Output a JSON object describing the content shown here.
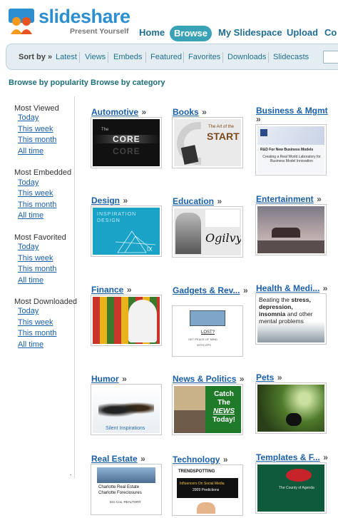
{
  "header": {
    "logo_word": "slideshare",
    "logo_tagline": "Present Yourself",
    "nav": {
      "home": "Home",
      "browse": "Browse",
      "my_slidespace": "My Slidespace",
      "upload": "Upload",
      "community_partial": "Co"
    }
  },
  "sort_bar": {
    "label": "Sort by »",
    "items": [
      "Latest",
      "Views",
      "Embeds",
      "Featured",
      "Favorites",
      "Downloads",
      "Slidecasts"
    ]
  },
  "tabs": {
    "by_popularity": "Browse by popularity",
    "by_category": "Browse by category"
  },
  "sidebar": {
    "groups": [
      {
        "title": "Most Viewed",
        "links": [
          "Today",
          "This week",
          "This month",
          "All time"
        ]
      },
      {
        "title": "Most Embedded",
        "links": [
          "Today",
          "This week",
          "This month",
          "All time"
        ]
      },
      {
        "title": "Most Favorited",
        "links": [
          "Today",
          "This week",
          "This month",
          "All time"
        ]
      },
      {
        "title": "Most Downloaded",
        "links": [
          "Today",
          "This week",
          "This month",
          "All time"
        ]
      }
    ],
    "footer_dot": "."
  },
  "categories": [
    {
      "name": "Automotive",
      "arrow": "»",
      "thumb_text": [
        "The",
        "CORE",
        "CORE"
      ]
    },
    {
      "name": "Books",
      "arrow": "»",
      "thumb_text": [
        "The Art of the",
        "START"
      ]
    },
    {
      "name": "Business & Mgmt",
      "arrow": "»",
      "thumb_text": [
        "R&D For New Business Models",
        "Creating a Real World Laboratory for Business Model Innovation"
      ]
    },
    {
      "name": "Design",
      "arrow": "»",
      "thumb_text": [
        "INSPIRATION",
        "DESIGN",
        "IX"
      ]
    },
    {
      "name": "Education",
      "arrow": "»",
      "thumb_text": [
        "Ogilvy"
      ]
    },
    {
      "name": "Entertainment",
      "arrow": "»",
      "thumb_text": []
    },
    {
      "name": "Finance",
      "arrow": "»",
      "thumb_text": []
    },
    {
      "name": "Gadgets & Rev...",
      "arrow": "»",
      "thumb_text": [
        "LOST?",
        "GET PEACE OF MIND",
        "WITH GPS"
      ]
    },
    {
      "name": "Health & Medi...",
      "arrow": "»",
      "thumb_text": [
        "Beating the",
        "stress,",
        "depression,",
        "insomnia",
        "and other",
        "mental problems"
      ]
    },
    {
      "name": "Humor",
      "arrow": "»",
      "thumb_text": [
        "Silent Inspirations"
      ]
    },
    {
      "name": "News & Politics",
      "arrow": "»",
      "thumb_text": [
        "Catch",
        "The",
        "NEWS",
        "Today!"
      ]
    },
    {
      "name": "Pets",
      "arrow": "»",
      "thumb_text": []
    },
    {
      "name": "Real Estate",
      "arrow": "»",
      "thumb_text": [
        "Charlotte Real Estate",
        "Charlotte Foreclosures",
        "Eric Cox, REALTOR®"
      ]
    },
    {
      "name": "Technology",
      "arrow": "»",
      "thumb_text": [
        "TRENDSPOTTING",
        "Influencers On Social Media",
        "2009 Predictions"
      ]
    },
    {
      "name": "Templates & F...",
      "arrow": "»",
      "thumb_text": [
        "The County of Agenda"
      ]
    }
  ],
  "colors": {
    "brand_blue": "#2d8fd0",
    "nav_teal": "#1e6e92",
    "browse_pill": "#3aa2b7",
    "link_blue": "#1a5fa8",
    "sortbar_bg": "#e4eef2"
  }
}
